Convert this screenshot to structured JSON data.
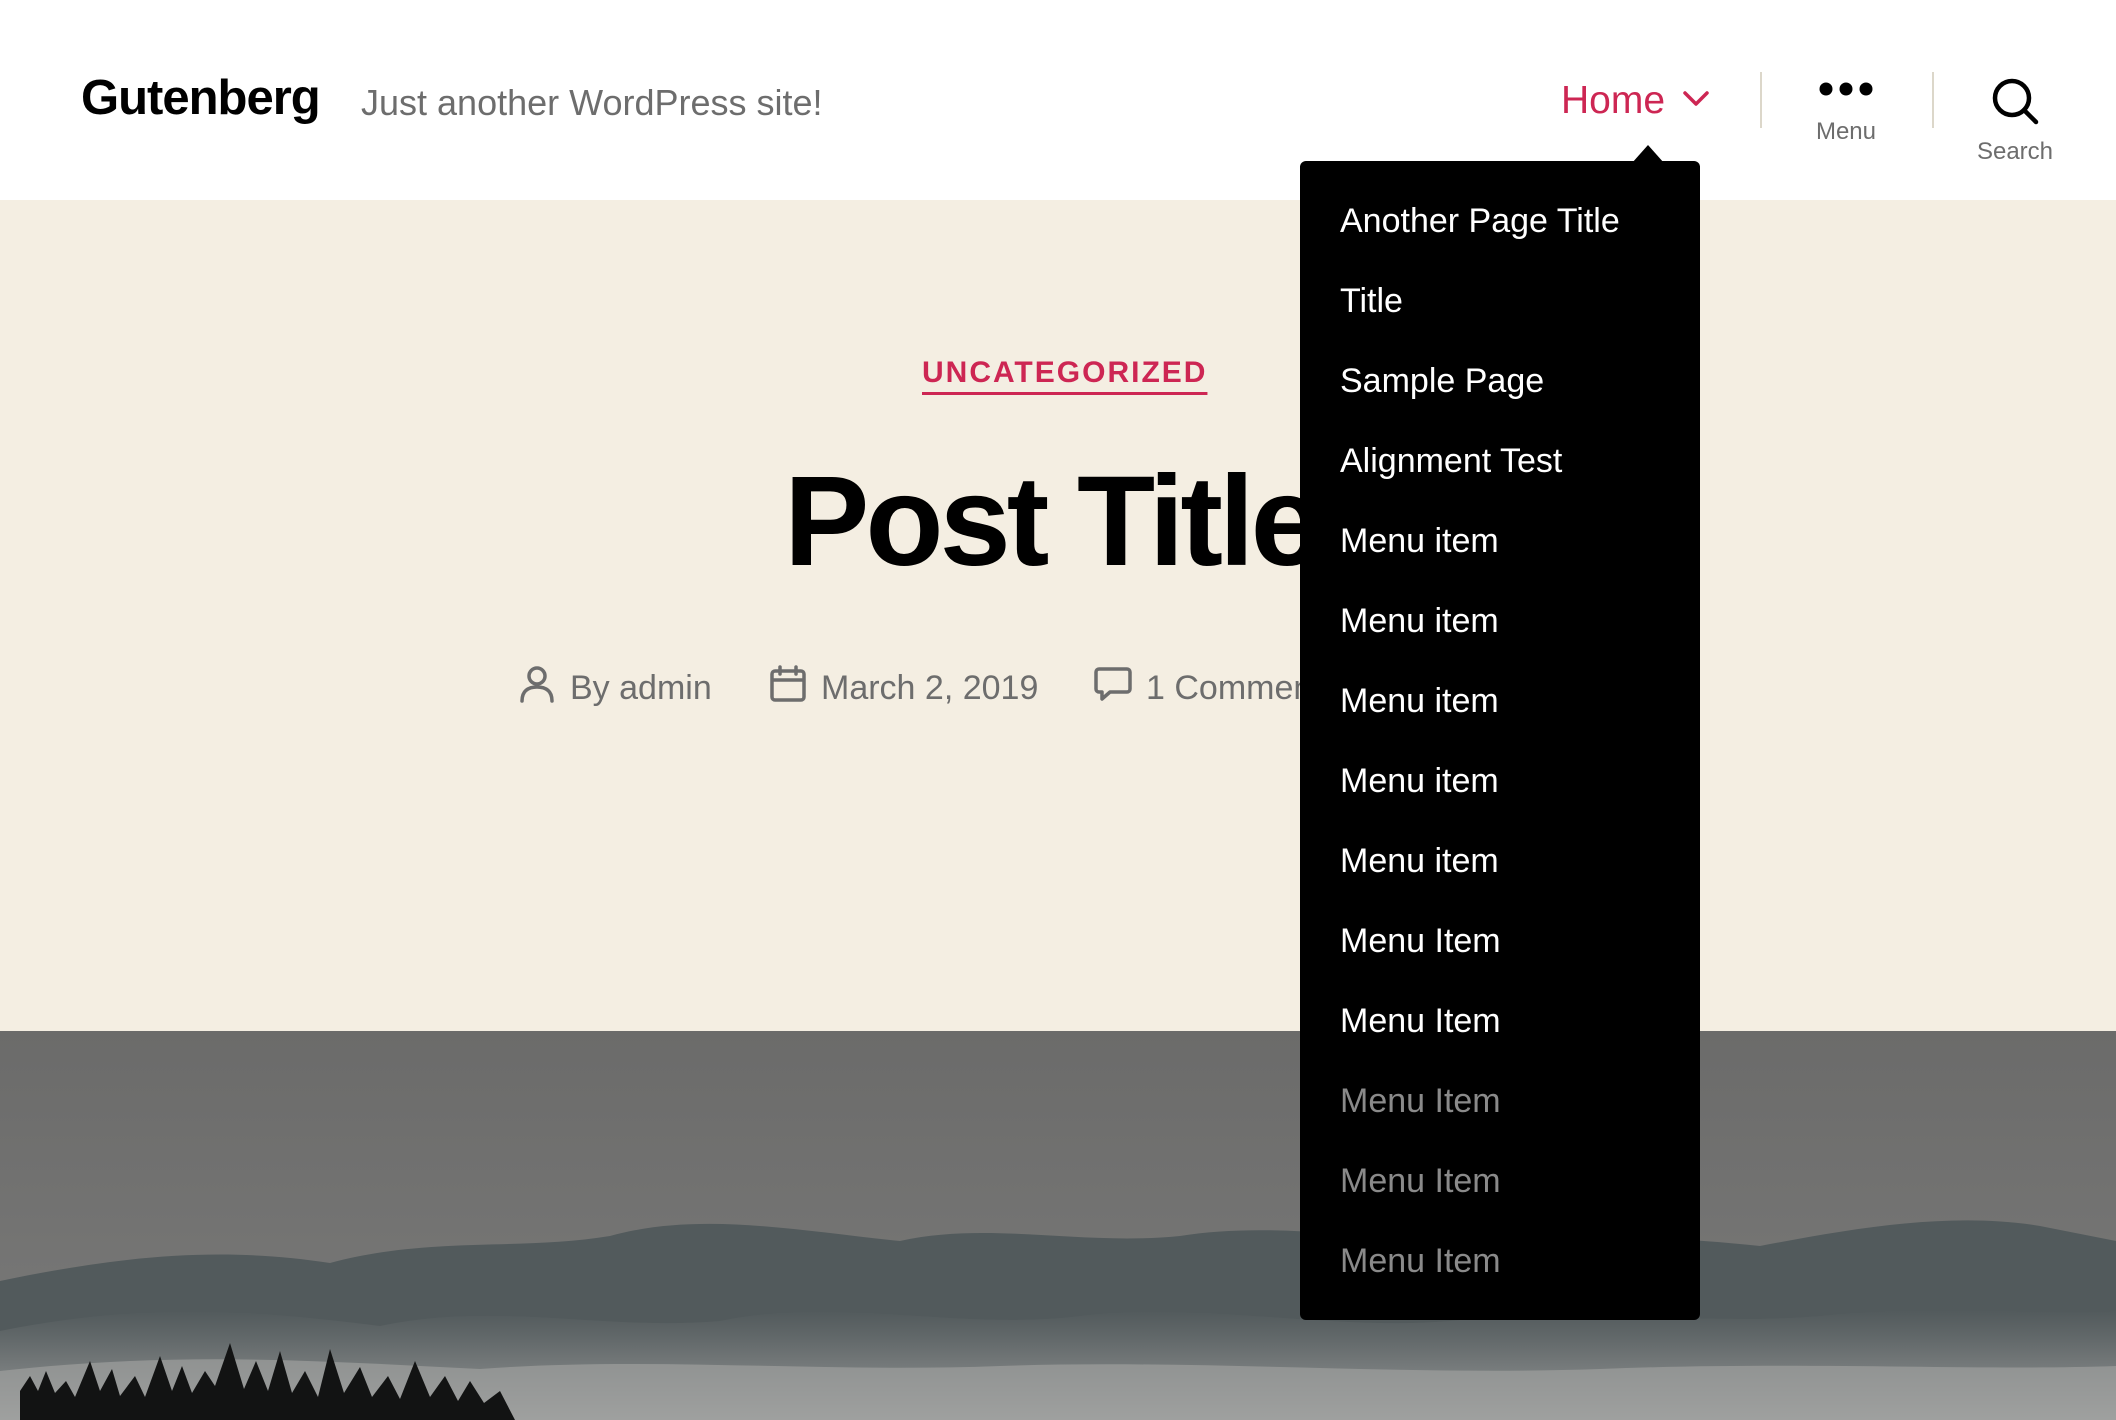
{
  "header": {
    "site_title": "Gutenberg",
    "tagline": "Just another WordPress site!",
    "nav": {
      "home_label": "Home"
    },
    "menu_toggle_label": "Menu",
    "search_toggle_label": "Search"
  },
  "dropdown": {
    "items": [
      {
        "label": "Another Page Title"
      },
      {
        "label": "Title"
      },
      {
        "label": "Sample Page"
      },
      {
        "label": "Alignment Test"
      },
      {
        "label": "Menu item"
      },
      {
        "label": "Menu item"
      },
      {
        "label": "Menu item"
      },
      {
        "label": "Menu item"
      },
      {
        "label": "Menu item"
      },
      {
        "label": "Menu Item"
      },
      {
        "label": "Menu Item"
      },
      {
        "label": "Menu Item"
      },
      {
        "label": "Menu Item"
      },
      {
        "label": "Menu Item"
      }
    ]
  },
  "entry": {
    "category": "UNCATEGORIZED",
    "title": "Post Title",
    "meta": {
      "author": "By admin",
      "date": "March 2, 2019",
      "comments": "1 Comment"
    }
  },
  "colors": {
    "accent": "#cd2653",
    "entry_header_bg": "#f4eee2",
    "dropdown_bg": "#000000",
    "secondary_text": "#6d6d6d"
  },
  "icons": {
    "nav_home": "chevron-down-icon",
    "menu_toggle": "ellipsis-icon",
    "search_toggle": "search-icon",
    "author": "user-icon",
    "date": "calendar-icon",
    "comments": "comment-icon"
  }
}
